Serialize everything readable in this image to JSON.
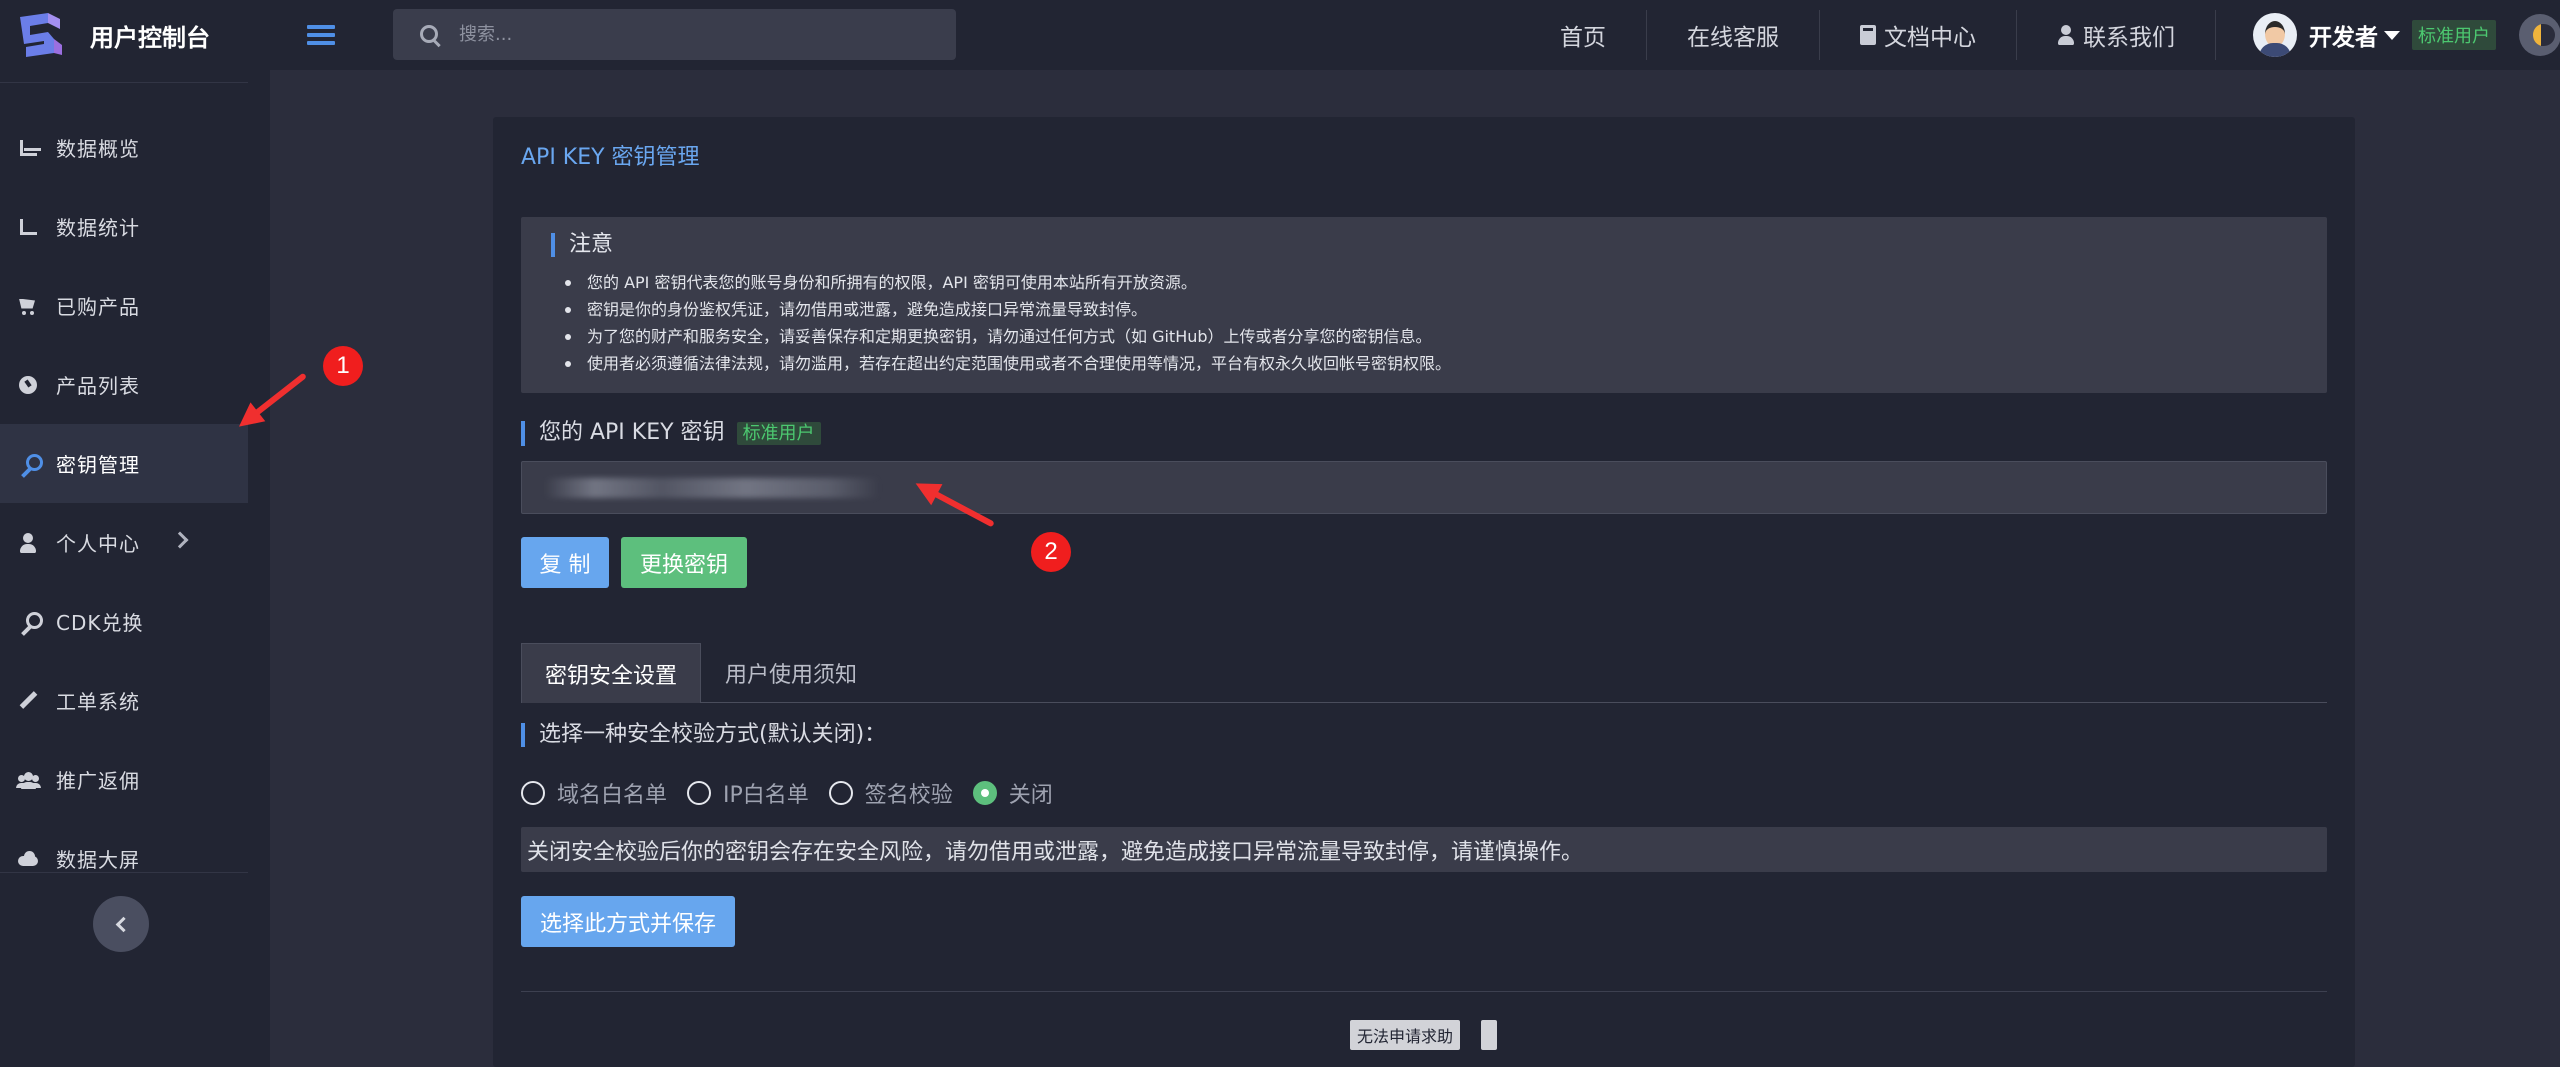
{
  "header": {
    "brand_title": "用户控制台",
    "search_placeholder": "搜索...",
    "nav": [
      "首页",
      "在线客服",
      "文档中心",
      "联系我们"
    ],
    "user_name": "开发者",
    "user_level": "标准用户"
  },
  "sidebar": {
    "items": [
      {
        "label": "数据概览",
        "icon": "area-chart-icon"
      },
      {
        "label": "数据统计",
        "icon": "line-chart-icon"
      },
      {
        "label": "已购产品",
        "icon": "cart-icon"
      },
      {
        "label": "产品列表",
        "icon": "gauge-icon"
      },
      {
        "label": "密钥管理",
        "icon": "key-icon",
        "active": true
      },
      {
        "label": "个人中心",
        "icon": "user-icon"
      },
      {
        "label": "CDK兑换",
        "icon": "key-icon"
      },
      {
        "label": "工单系统",
        "icon": "pencil-icon"
      },
      {
        "label": "推广返佣",
        "icon": "users-icon"
      },
      {
        "label": "数据大屏",
        "icon": "cloud-icon"
      }
    ]
  },
  "annotations": {
    "marker_1": "1",
    "marker_2": "2"
  },
  "panel": {
    "title": "API KEY 密钥管理",
    "notice_title": "注意",
    "notice_items": [
      "您的 API 密钥代表您的账号身份和所拥有的权限，API 密钥可使用本站所有开放资源。",
      "密钥是你的身份鉴权凭证，请勿借用或泄露，避免造成接口异常流量导致封停。",
      "为了您的财产和服务安全，请妥善保存和定期更换密钥，请勿通过任何方式（如 GitHub）上传或者分享您的密钥信息。",
      "使用者必须遵循法律法规，请勿滥用，若存在超出约定范围使用或者不合理使用等情况，平台有权永久收回帐号密钥权限。"
    ],
    "key_section_title": "您的 API KEY 密钥",
    "key_section_tag": "标准用户",
    "copy_button": "复 制",
    "rotate_button": "更换密钥",
    "tabs": [
      "密钥安全设置",
      "用户使用须知"
    ],
    "security_title": "选择一种安全校验方式(默认关闭)：",
    "radio_options": [
      "域名白名单",
      "IP白名单",
      "签名校验",
      "关闭"
    ],
    "selected_option": "关闭",
    "warning_text": "关闭安全校验后你的密钥会存在安全风险，请勿借用或泄露，避免造成接口异常流量导致封停，请谨慎操作。",
    "save_button": "选择此方式并保存",
    "help_button": "无法申请求助"
  },
  "colors": {
    "accent_blue": "#4f8fe6",
    "button_blue": "#67a6ee",
    "button_green": "#5dbf7d",
    "tag_green": "#4cc870",
    "annotation_red": "#f02f2f"
  }
}
